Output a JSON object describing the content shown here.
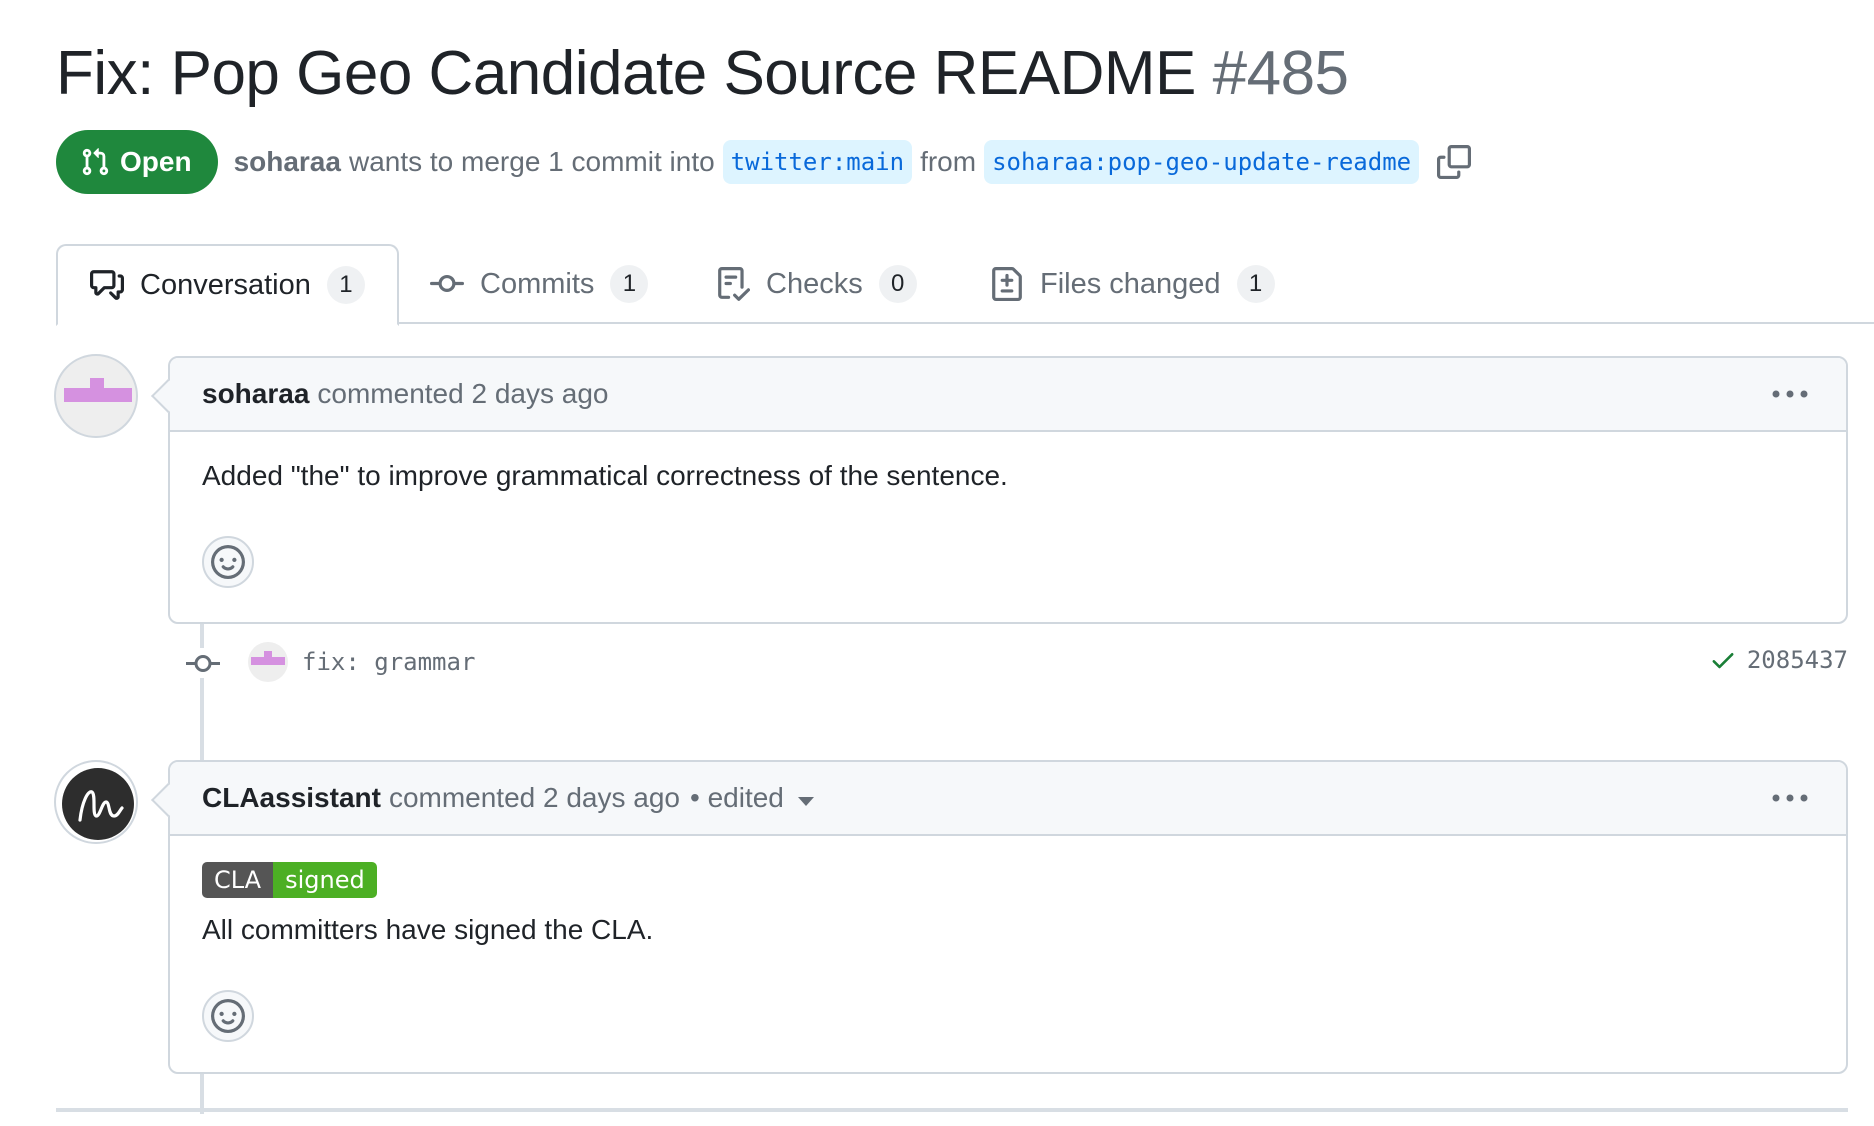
{
  "pr": {
    "title": "Fix: Pop Geo Candidate Source README",
    "number": "#485",
    "state": "Open",
    "author": "soharaa",
    "merge_text": "wants to merge 1 commit into",
    "base_branch": "twitter:main",
    "from_text": "from",
    "head_branch": "soharaa:pop-geo-update-readme"
  },
  "tabs": [
    {
      "label": "Conversation",
      "count": "1",
      "icon": "comment-discussion-icon",
      "active": true
    },
    {
      "label": "Commits",
      "count": "1",
      "icon": "git-commit-icon",
      "active": false
    },
    {
      "label": "Checks",
      "count": "0",
      "icon": "checklist-icon",
      "active": false
    },
    {
      "label": "Files changed",
      "count": "1",
      "icon": "file-diff-icon",
      "active": false
    }
  ],
  "comments": [
    {
      "author": "soharaa",
      "action": "commented 2 days ago",
      "body": "Added \"the\" to improve grammatical correctness of the sentence."
    },
    {
      "author": "CLAassistant",
      "action": "commented 2 days ago",
      "edited": "• edited",
      "badge_left": "CLA",
      "badge_right": "signed",
      "body": "All committers have signed the CLA."
    }
  ],
  "commit": {
    "message": "fix: grammar",
    "sha": "2085437",
    "status": "success"
  },
  "colors": {
    "open_green": "#1f883d",
    "link_blue": "#0969da",
    "branch_bg": "#ddf4ff",
    "muted": "#656d76",
    "border": "#d0d7de",
    "identicon": "#d591e0",
    "cla_green": "#4caf24"
  }
}
